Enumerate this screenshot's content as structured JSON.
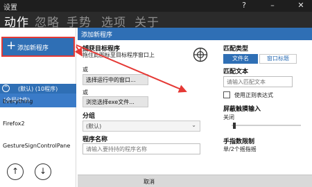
{
  "window": {
    "title": "设置",
    "help_label": "?",
    "minimize_label": "–",
    "close_label": "✕"
  },
  "nav": {
    "tabs": [
      "动作",
      "忽略",
      "手势",
      "选项",
      "关于"
    ]
  },
  "sidebar": {
    "add_program": "添加新程序",
    "group_label": "(默认) (10程序)",
    "global_action": "(全局动作)",
    "apps": [
      "Everything",
      "Firefox2",
      "GestureSignControlPane"
    ]
  },
  "dialog": {
    "title": "添加新程序",
    "capture_title": "捕获目标程序",
    "capture_hint": "拖住此图标至目标程序窗口上",
    "or1": "或",
    "select_window_button": "选择运行中的窗口...",
    "or2": "或",
    "browse_exe_button": "浏览选择exe文件...",
    "group_title": "分组",
    "group_value": "(默认)",
    "program_name_title": "程序名称",
    "program_name_placeholder": "请输入要持持的程序名称",
    "match_type_title": "匹配类型",
    "match_filename": "文件名",
    "match_window_title": "窗口标题",
    "match_text_title": "匹配文本",
    "match_text_placeholder": "请输入匹配文本",
    "regex_label": "使用正则表达式",
    "block_touch_title": "屏蔽触摸输入",
    "block_touch_value": "关闭",
    "limit_title": "手指数限制",
    "limit_value": "单/2个摇指摇",
    "cancel_label": "取消"
  },
  "colors": {
    "accent": "#2f6fb5",
    "annotation": "#e53935",
    "titlebar": "#1e1e1e",
    "nav_bar": "#2b2b2b"
  },
  "icons": {
    "add": "plus-icon",
    "group": "collapse-icon",
    "crosshair": "crosshair-target-icon",
    "import": "upload-icon",
    "export": "download-icon",
    "dropdown": "chevron-down-icon"
  }
}
